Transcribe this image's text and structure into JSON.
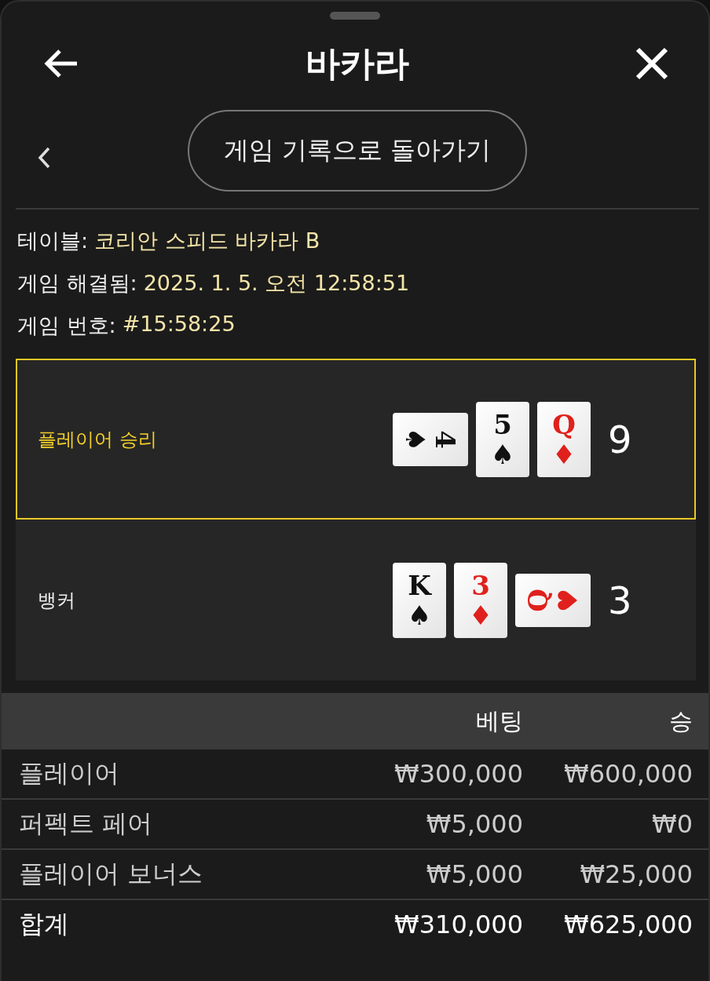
{
  "header": {
    "title": "바카라"
  },
  "back_to_history": {
    "label": "게임 기록으로 돌아가기"
  },
  "info": [
    {
      "label": "테이블:",
      "value": "코리안 스피드 바카라 B"
    },
    {
      "label": "게임 해결됨:",
      "value": "2025. 1. 5. 오전 12:58:51"
    },
    {
      "label": "게임 번호:",
      "value": "#15:58:25"
    }
  ],
  "hands": [
    {
      "name": "플레이어 승리",
      "selected": true,
      "score": "9",
      "cards": [
        {
          "rank": "4",
          "suit": "♠",
          "color": "#111111",
          "kind": "clockwise"
        },
        {
          "rank": "5",
          "suit": "♠",
          "color": "#111111",
          "kind": "upright"
        },
        {
          "rank": "Q",
          "suit": "♦",
          "color": "#e0201c",
          "kind": "upright"
        }
      ]
    },
    {
      "name": "뱅커",
      "selected": false,
      "score": "3",
      "cards": [
        {
          "rank": "K",
          "suit": "♠",
          "color": "#111111",
          "kind": "upright"
        },
        {
          "rank": "3",
          "suit": "♦",
          "color": "#e0201c",
          "kind": "upright"
        },
        {
          "rank": "Q",
          "suit": "♥",
          "color": "#e0201c",
          "kind": "counterclockwise"
        }
      ]
    }
  ],
  "bets_table": {
    "columns": [
      "베팅",
      "승"
    ],
    "rows": [
      {
        "name": "플레이어",
        "bet": "₩300,000",
        "win": "₩600,000"
      },
      {
        "name": "퍼펙트 페어",
        "bet": "₩5,000",
        "win": "₩0"
      },
      {
        "name": "플레이어 보너스",
        "bet": "₩5,000",
        "win": "₩25,000"
      }
    ],
    "total": {
      "name": "합계",
      "bet": "₩310,000",
      "win": "₩625,000"
    }
  }
}
